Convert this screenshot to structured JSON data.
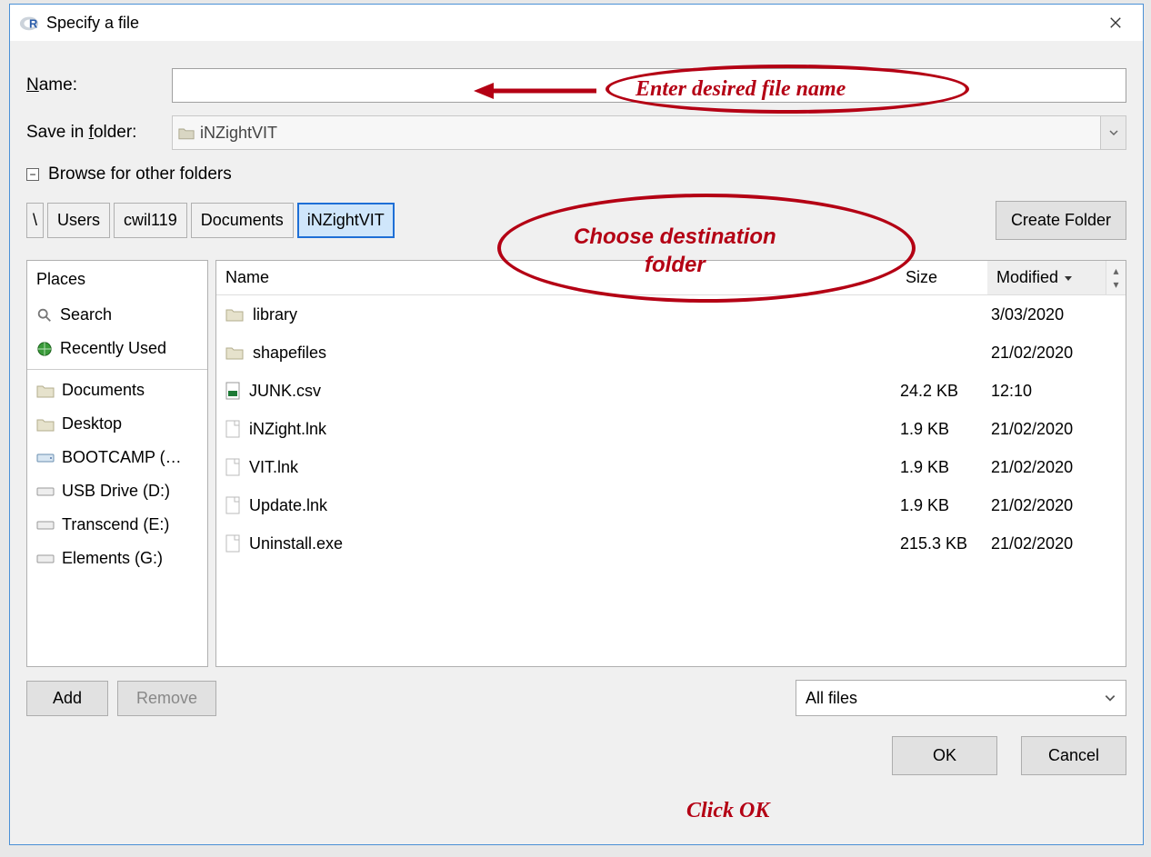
{
  "window": {
    "title": "Specify a file"
  },
  "name_row": {
    "label": "Name:",
    "value": ""
  },
  "save_in": {
    "label": "Save in folder:",
    "folder": "iNZightVIT"
  },
  "expander": {
    "label": "Browse for other folders",
    "symbol": "−"
  },
  "breadcrumbs": {
    "root": "\\",
    "items": [
      "Users",
      "cwil119",
      "Documents",
      "iNZightVIT"
    ],
    "active_index": 3
  },
  "create_folder": "Create Folder",
  "places": {
    "header": "Places",
    "search": "Search",
    "recent": "Recently Used",
    "items": [
      "Documents",
      "Desktop",
      "BOOTCAMP (…",
      "USB Drive (D:)",
      "Transcend (E:)",
      "Elements (G:)"
    ]
  },
  "columns": {
    "name": "Name",
    "size": "Size",
    "modified": "Modified"
  },
  "files": [
    {
      "icon": "folder",
      "name": "library",
      "size": "",
      "modified": "3/03/2020"
    },
    {
      "icon": "folder",
      "name": "shapefiles",
      "size": "",
      "modified": "21/02/2020"
    },
    {
      "icon": "csv",
      "name": "JUNK.csv",
      "size": "24.2 KB",
      "modified": "12:10"
    },
    {
      "icon": "file",
      "name": "iNZight.lnk",
      "size": "1.9 KB",
      "modified": "21/02/2020"
    },
    {
      "icon": "file",
      "name": "VIT.lnk",
      "size": "1.9 KB",
      "modified": "21/02/2020"
    },
    {
      "icon": "file",
      "name": "Update.lnk",
      "size": "1.9 KB",
      "modified": "21/02/2020"
    },
    {
      "icon": "file",
      "name": "Uninstall.exe",
      "size": "215.3 KB",
      "modified": "21/02/2020"
    }
  ],
  "buttons": {
    "add": "Add",
    "remove": "Remove",
    "ok": "OK",
    "cancel": "Cancel"
  },
  "filter": {
    "label": "All files"
  },
  "annotations": {
    "enter_name": "Enter desired file name",
    "choose_folder_l1": "Choose destination",
    "choose_folder_l2": "folder",
    "click_ok": "Click OK"
  }
}
